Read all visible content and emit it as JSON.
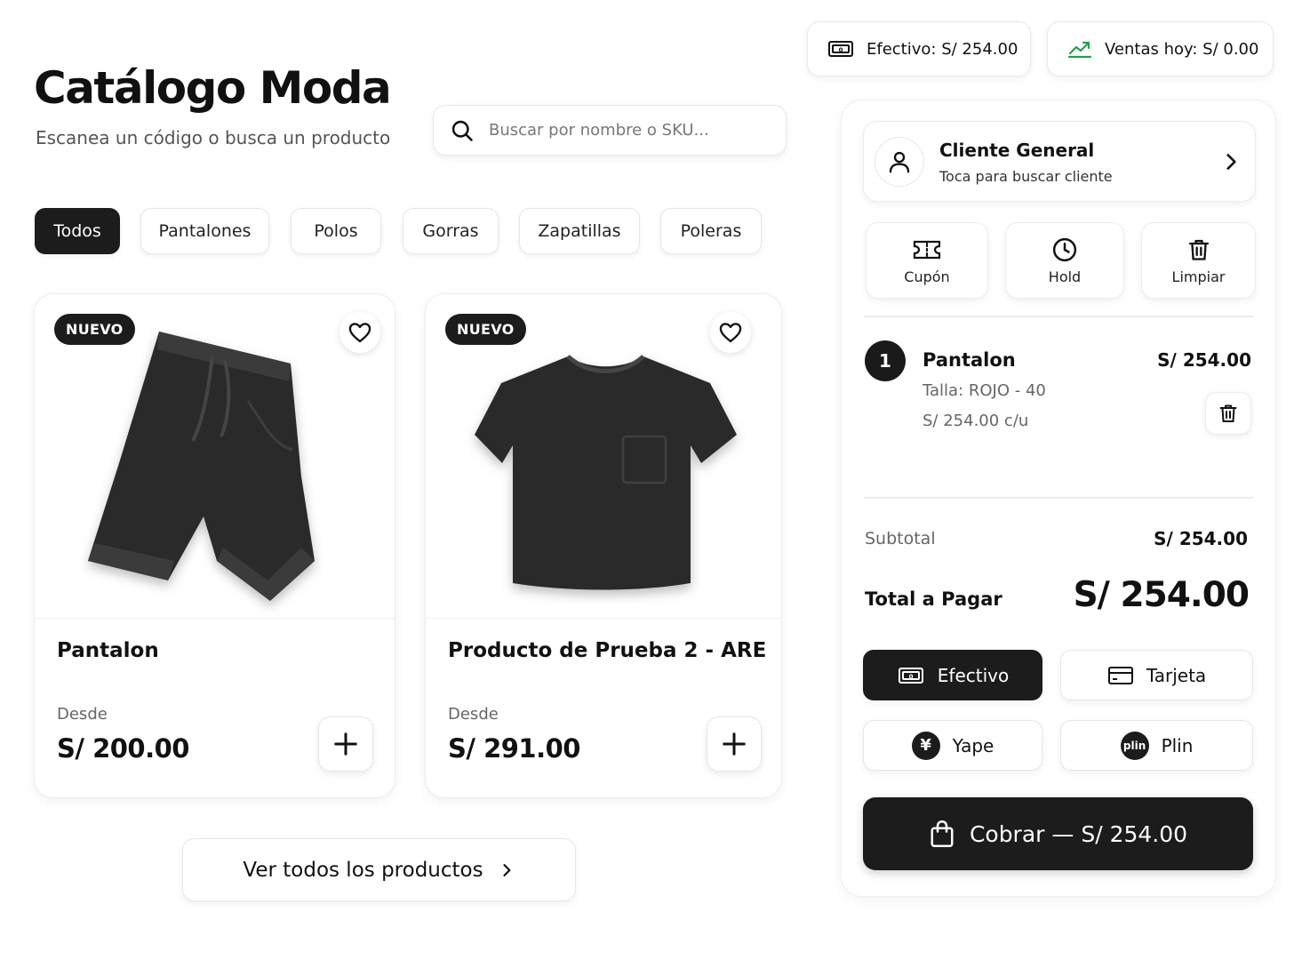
{
  "header": {
    "title": "Catálogo Moda",
    "subtitle": "Escanea un código o busca un producto"
  },
  "search": {
    "placeholder": "Buscar por nombre o SKU..."
  },
  "categories": [
    {
      "label": "Todos",
      "active": true
    },
    {
      "label": "Pantalones",
      "active": false
    },
    {
      "label": "Polos",
      "active": false
    },
    {
      "label": "Gorras",
      "active": false
    },
    {
      "label": "Zapatillas",
      "active": false
    },
    {
      "label": "Poleras",
      "active": false
    }
  ],
  "products": [
    {
      "badge": "NUEVO",
      "name": "Pantalon",
      "price_label": "Desde",
      "price": "S/ 200.00",
      "image_icon": "pants-image"
    },
    {
      "badge": "NUEVO",
      "name": "Producto de Prueba 2 - ARE",
      "price_label": "Desde",
      "price": "S/ 291.00",
      "image_icon": "tshirt-image"
    }
  ],
  "view_all": {
    "label": "Ver todos los productos"
  },
  "stats": {
    "cash": {
      "label": "Efectivo:",
      "value": "S/ 254.00",
      "icon": "cash-icon"
    },
    "sales": {
      "label": "Ventas hoy:",
      "value": "S/ 0.00",
      "icon": "trend-up-icon",
      "color": "#22a04b"
    }
  },
  "client": {
    "name": "Cliente General",
    "hint": "Toca para buscar cliente"
  },
  "actions": [
    {
      "label": "Cupón",
      "icon": "coupon-icon"
    },
    {
      "label": "Hold",
      "icon": "clock-icon"
    },
    {
      "label": "Limpiar",
      "icon": "trash-icon"
    }
  ],
  "cart": {
    "items": [
      {
        "qty": "1",
        "name": "Pantalon",
        "total": "S/ 254.00",
        "variant": "Talla: ROJO - 40",
        "unit": "S/ 254.00 c/u"
      }
    ]
  },
  "summary": {
    "subtotal_label": "Subtotal",
    "subtotal": "S/ 254.00",
    "total_label": "Total a Pagar",
    "total": "S/ 254.00"
  },
  "payments": [
    {
      "label": "Efectivo",
      "icon": "cash-icon",
      "active": true
    },
    {
      "label": "Tarjeta",
      "icon": "card-icon",
      "active": false
    },
    {
      "label": "Yape",
      "icon": "yape-logo",
      "logo_text": "¥",
      "active": false
    },
    {
      "label": "Plin",
      "icon": "plin-logo",
      "logo_text": "plin",
      "active": false
    }
  ],
  "checkout": {
    "label": "Cobrar — S/ 254.00"
  },
  "colors": {
    "primary": "#1c1c1c",
    "accent_green": "#22a04b",
    "background": "#ffffff"
  }
}
